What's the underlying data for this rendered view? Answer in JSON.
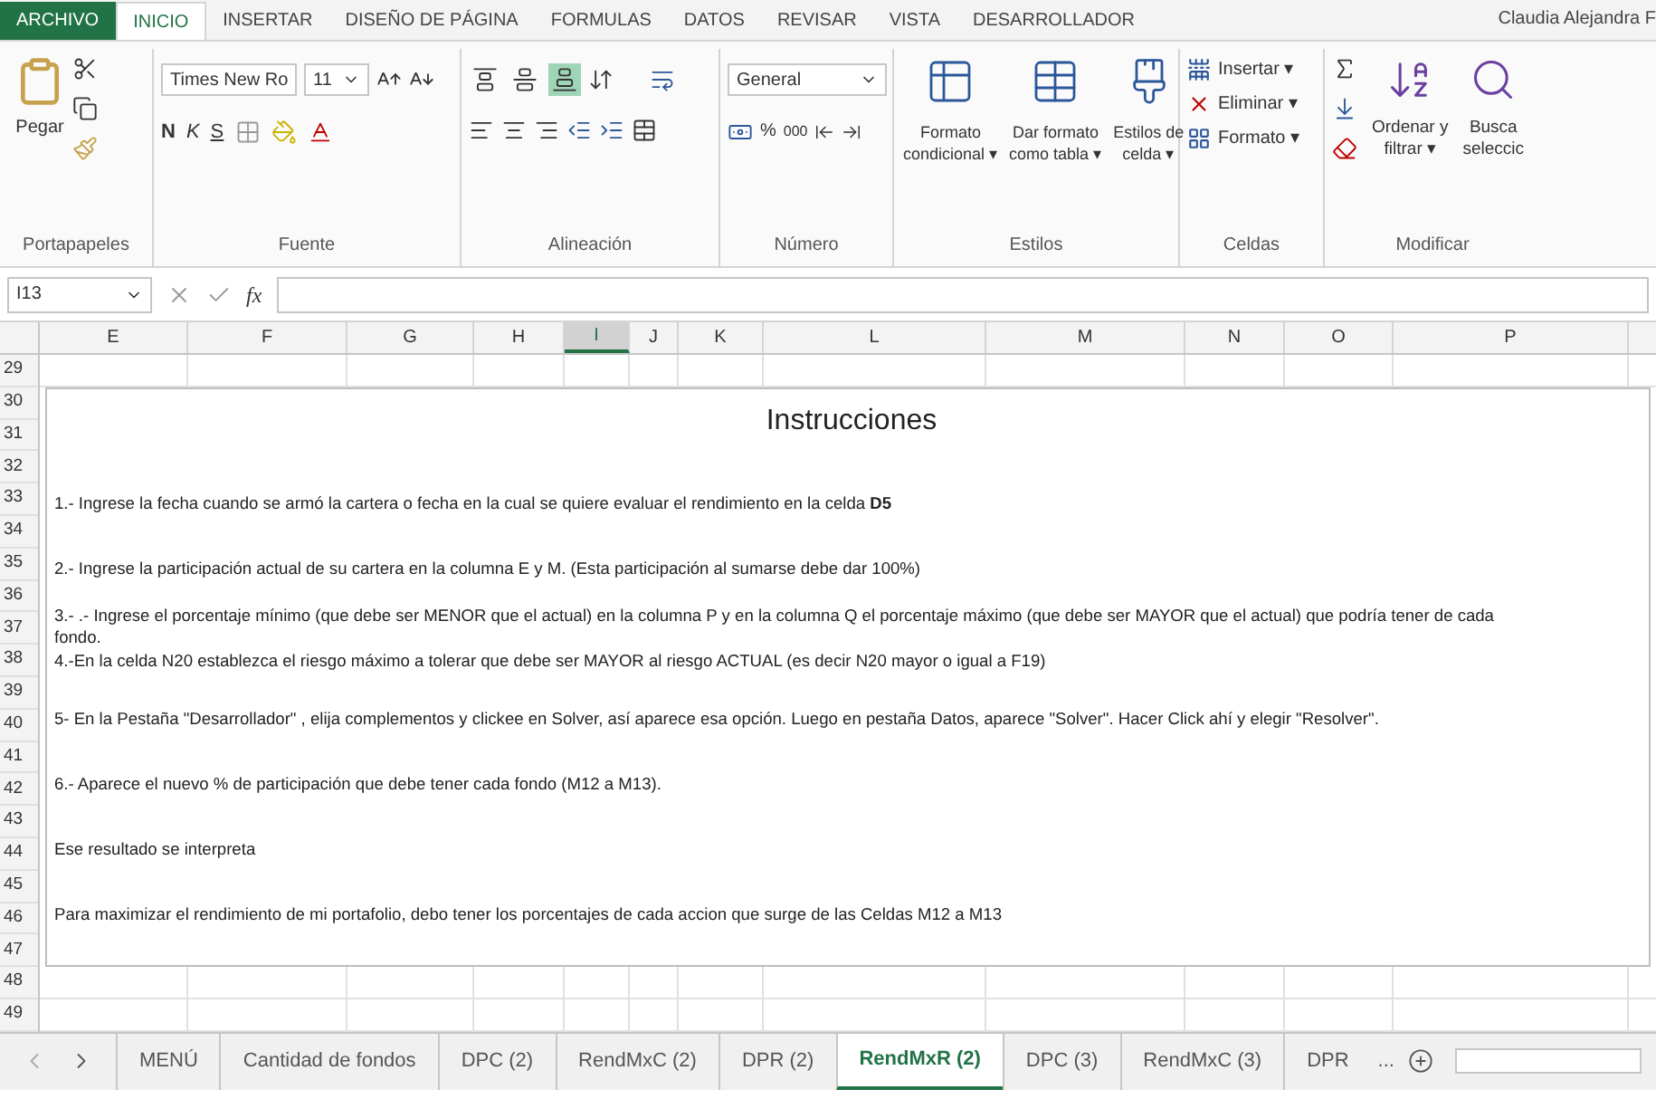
{
  "ribbon_tabs": [
    {
      "label": "ARCHIVO",
      "kind": "file",
      "selected": false
    },
    {
      "label": "INICIO",
      "kind": "tab",
      "selected": true
    },
    {
      "label": "INSERTAR",
      "kind": "tab",
      "selected": false
    },
    {
      "label": "DISEÑO DE PÁGINA",
      "kind": "tab",
      "selected": false
    },
    {
      "label": "FORMULAS",
      "kind": "tab",
      "selected": false
    },
    {
      "label": "DATOS",
      "kind": "tab",
      "selected": false
    },
    {
      "label": "REVISAR",
      "kind": "tab",
      "selected": false
    },
    {
      "label": "VISTA",
      "kind": "tab",
      "selected": false
    },
    {
      "label": "DESARROLLADOR",
      "kind": "tab",
      "selected": false
    }
  ],
  "user_name": "Claudia Alejandra F",
  "clipboard": {
    "label": "Portapapeles",
    "paste": "Pegar"
  },
  "font": {
    "label": "Fuente",
    "font_name": "Times New Ro",
    "font_size": "11",
    "bold": "N",
    "italic": "K",
    "underline": "S"
  },
  "alignment": {
    "label": "Alineación",
    "vertical": [
      {
        "selected": false
      },
      {
        "selected": false
      },
      {
        "selected": true
      }
    ]
  },
  "number": {
    "label": "Número",
    "format": "General",
    "percent": "%",
    "thousands": "000"
  },
  "styles": {
    "label": "Estilos",
    "buttons": [
      {
        "lines": [
          "Formato",
          "condicional ▾"
        ]
      },
      {
        "lines": [
          "Dar formato",
          "como tabla ▾"
        ]
      },
      {
        "lines": [
          "Estilos de",
          "celda ▾"
        ]
      }
    ]
  },
  "cells": {
    "label": "Celdas",
    "buttons": [
      "Insertar ▾",
      "Eliminar ▾",
      "Formato ▾"
    ]
  },
  "editing": {
    "label": "Modificar",
    "buttons": [
      {
        "lines": [
          "Ordenar y",
          "filtrar ▾"
        ]
      },
      {
        "lines": [
          "Busca",
          "seleccic"
        ]
      }
    ]
  },
  "formula_bar": {
    "name_box": "I13",
    "fx": "fx"
  },
  "columns": [
    {
      "label": "E",
      "selected": false
    },
    {
      "label": "F",
      "selected": false
    },
    {
      "label": "G",
      "selected": false
    },
    {
      "label": "H",
      "selected": false
    },
    {
      "label": "I",
      "selected": true
    },
    {
      "label": "J",
      "selected": false
    },
    {
      "label": "K",
      "selected": false
    },
    {
      "label": "L",
      "selected": false
    },
    {
      "label": "M",
      "selected": false
    },
    {
      "label": "N",
      "selected": false
    },
    {
      "label": "O",
      "selected": false
    },
    {
      "label": "P",
      "selected": false
    }
  ],
  "row_numbers": [
    "29",
    "30",
    "31",
    "32",
    "33",
    "34",
    "35",
    "36",
    "37",
    "38",
    "39",
    "40",
    "41",
    "42",
    "43",
    "44",
    "45",
    "46",
    "47",
    "48",
    "49"
  ],
  "instructions": {
    "title": "Instrucciones",
    "paragraphs": [
      "1.- Ingrese la fecha cuando se armó la cartera o fecha en la cual se quiere evaluar el rendimiento en la celda **D5**",
      "2.- Ingrese la participación actual de su cartera en la columna E y M. (Esta participación al sumarse debe dar 100%)",
      "3.- .- Ingrese el porcentaje mínimo (que debe ser MENOR que el actual) en la columna P y en la columna Q el porcentaje máximo (que debe ser MAYOR que el actual) que podría tener de cada fondo.",
      "4.-En la celda N20 establezca el riesgo máximo a tolerar que debe ser MAYOR al riesgo ACTUAL (es decir N20 mayor o igual a F19)",
      "5- En la Pestaña \"Desarrollador\" , elija complementos y clickee en Solver, así aparece esa opción.  Luego en pestaña Datos, aparece \"Solver\".  Hacer Click ahí y elegir \"Resolver\".",
      "6.- Aparece el nuevo % de participación que debe tener cada fondo (M12 a M13).",
      "Ese resultado se interpreta",
      "Para maximizar el rendimiento de mi portafolio, debo tener los porcentajes de cada accion que surge de las Celdas M12 a M13"
    ]
  },
  "sheet_tabs": [
    {
      "label": "MENÚ",
      "selected": false
    },
    {
      "label": "Cantidad de fondos",
      "selected": false
    },
    {
      "label": "DPC (2)",
      "selected": false
    },
    {
      "label": "RendMxC (2)",
      "selected": false
    },
    {
      "label": "DPR  (2)",
      "selected": false
    },
    {
      "label": "RendMxR (2)",
      "selected": true
    },
    {
      "label": "DPC (3)",
      "selected": false
    },
    {
      "label": "RendMxC (3)",
      "selected": false
    },
    {
      "label": "DPR",
      "selected": false
    }
  ],
  "more_tabs": "..."
}
